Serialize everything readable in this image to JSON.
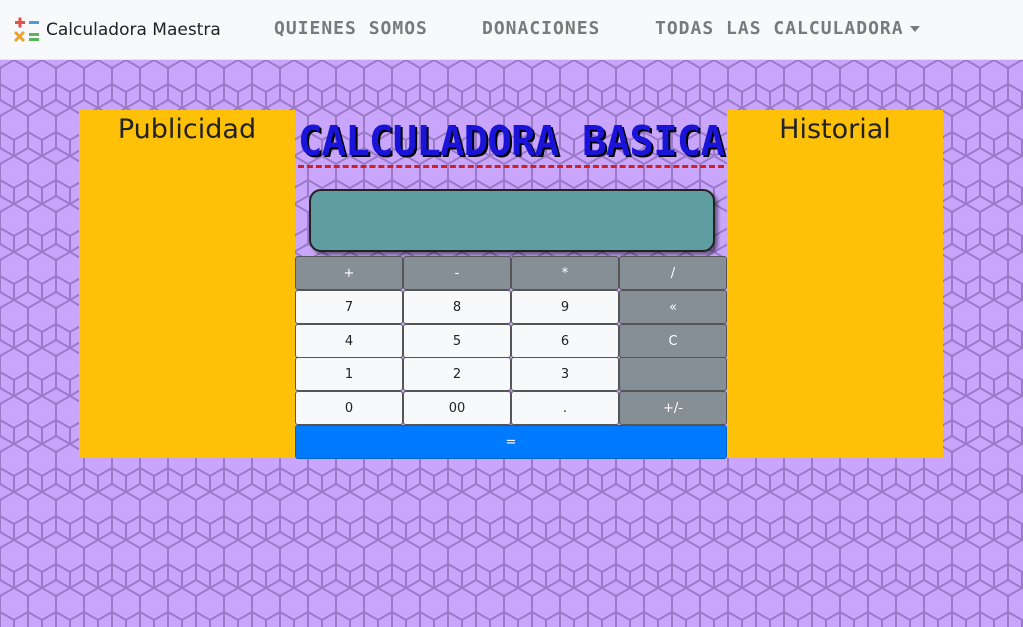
{
  "navbar": {
    "brand": "Calculadora Maestra",
    "links": {
      "quienes": "Quienes Somos",
      "donaciones": "Donaciones",
      "todas": "Todas las calculadora"
    }
  },
  "panels": {
    "left_title": "Publicidad",
    "right_title": "Historial"
  },
  "calculator": {
    "title": "CALCULADORA BASICA",
    "display_value": "",
    "keys": {
      "plus": "+",
      "minus": "-",
      "multiply": "*",
      "divide": "/",
      "seven": "7",
      "eight": "8",
      "nine": "9",
      "backspace": "«",
      "four": "4",
      "five": "5",
      "six": "6",
      "clear": "C",
      "one": "1",
      "two": "2",
      "three": "3",
      "blank": "",
      "zero": "0",
      "double_zero": "00",
      "dot": ".",
      "sign": "+/-",
      "equals": "="
    }
  },
  "colors": {
    "navbar_bg": "#f8f9fa",
    "page_bg": "#c9a6fb",
    "panel_bg": "#ffc107",
    "display_bg": "#5f9ea0",
    "operator_key": "#868e96",
    "number_key": "#f8f9fa",
    "equals_key": "#007bff",
    "title_text": "#1a14d8"
  },
  "icons": {
    "brand": "calculator-operators-icon",
    "dropdown": "caret-down-icon"
  }
}
